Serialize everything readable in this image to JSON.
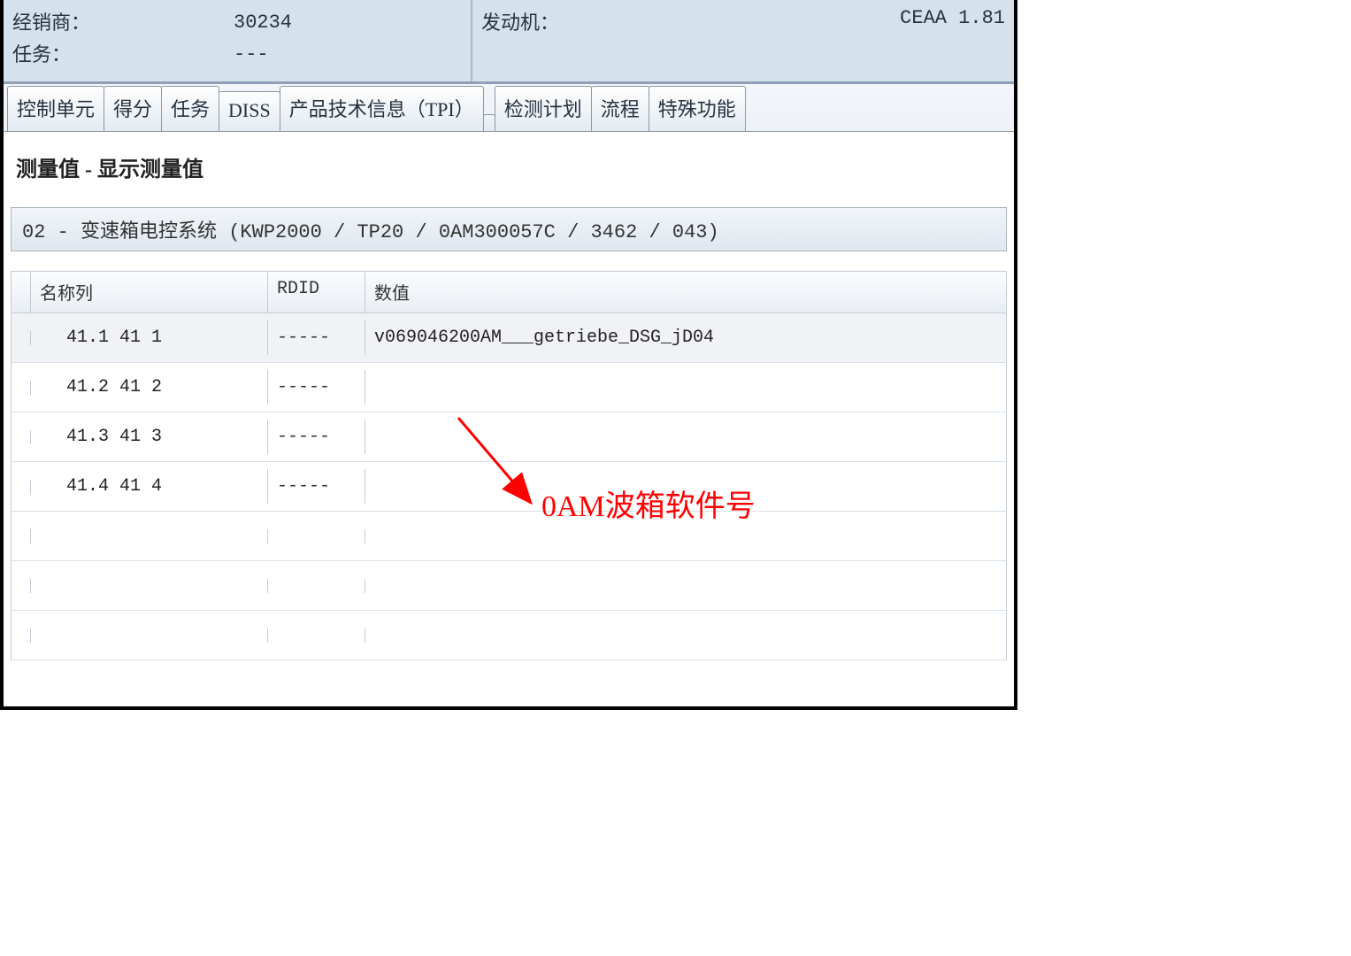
{
  "header": {
    "dealer_label": "经销商：",
    "dealer_value": "30234",
    "task_label": "任务：",
    "task_value": "---",
    "engine_label": "发动机：",
    "engine_value": "CEAA 1.81 "
  },
  "tabs": [
    "控制单元",
    "得分",
    "任务",
    "DISS",
    "产品技术信息（TPI）",
    "检测计划",
    "流程",
    "特殊功能"
  ],
  "section_title": "测量值 - 显示测量值",
  "subheader": "02 - 变速箱电控系统  (KWP2000 / TP20 / 0AM300057C   / 3462 / 043)",
  "table": {
    "columns": {
      "name": "名称列",
      "rdid": "RDID",
      "value": "数值"
    },
    "rows": [
      {
        "name": "41.1 41 1",
        "rdid": "-----",
        "value": "v069046200AM___getriebe_DSG_jD04"
      },
      {
        "name": "41.2 41 2",
        "rdid": "-----",
        "value": ""
      },
      {
        "name": "41.3 41 3",
        "rdid": "-----",
        "value": ""
      },
      {
        "name": "41.4 41 4",
        "rdid": "-----",
        "value": ""
      },
      {
        "name": "",
        "rdid": "",
        "value": ""
      },
      {
        "name": "",
        "rdid": "",
        "value": ""
      },
      {
        "name": "",
        "rdid": "",
        "value": ""
      }
    ]
  },
  "annotation": {
    "text": "0AM波箱软件号",
    "color": "#ff0000"
  }
}
